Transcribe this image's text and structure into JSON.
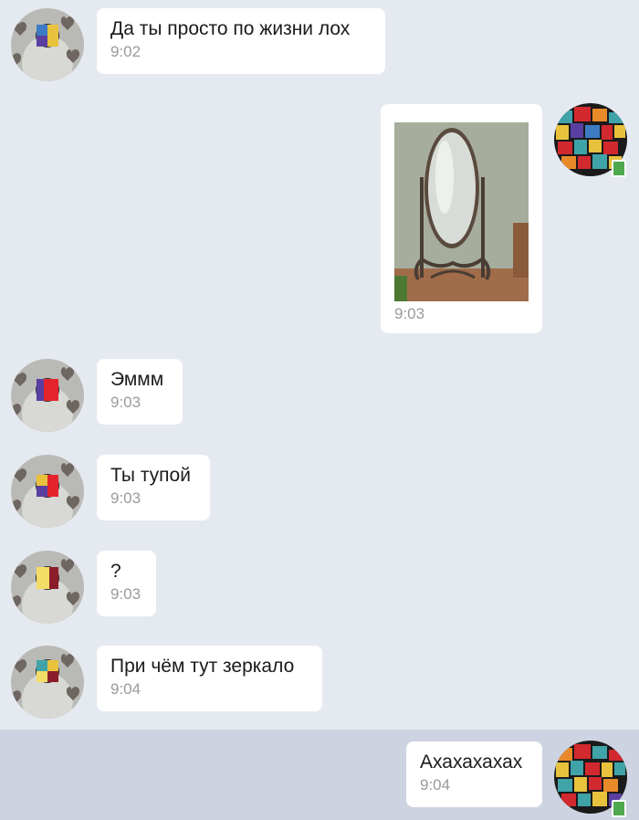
{
  "chat": {
    "messages": [
      {
        "sender": "friend",
        "text": "Да ты просто по жизни лох",
        "time": "9:02"
      },
      {
        "sender": "me",
        "type": "image",
        "image_label": "oval floor mirror",
        "time": "9:03"
      },
      {
        "sender": "friend",
        "text": "Эммм",
        "time": "9:03"
      },
      {
        "sender": "friend",
        "text": "Ты тупой",
        "time": "9:03"
      },
      {
        "sender": "friend",
        "text": "?",
        "time": "9:03"
      },
      {
        "sender": "friend",
        "text": "При чём тут зеркало",
        "time": "9:04"
      },
      {
        "sender": "me",
        "text": "Ахахахахах",
        "time": "9:04",
        "highlighted": true
      }
    ]
  },
  "colors": {
    "background": "#e5e9f0",
    "bubble": "#ffffff",
    "highlight": "#cdd3e0",
    "time_text": "#9a9a9a",
    "online_badge": "#4ea84e"
  },
  "icons": {
    "friend_avatar": "grey-hearts-avatar-icon",
    "my_avatar": "colorful-mosaic-avatar-icon",
    "online_indicator": "mobile-online-icon"
  }
}
